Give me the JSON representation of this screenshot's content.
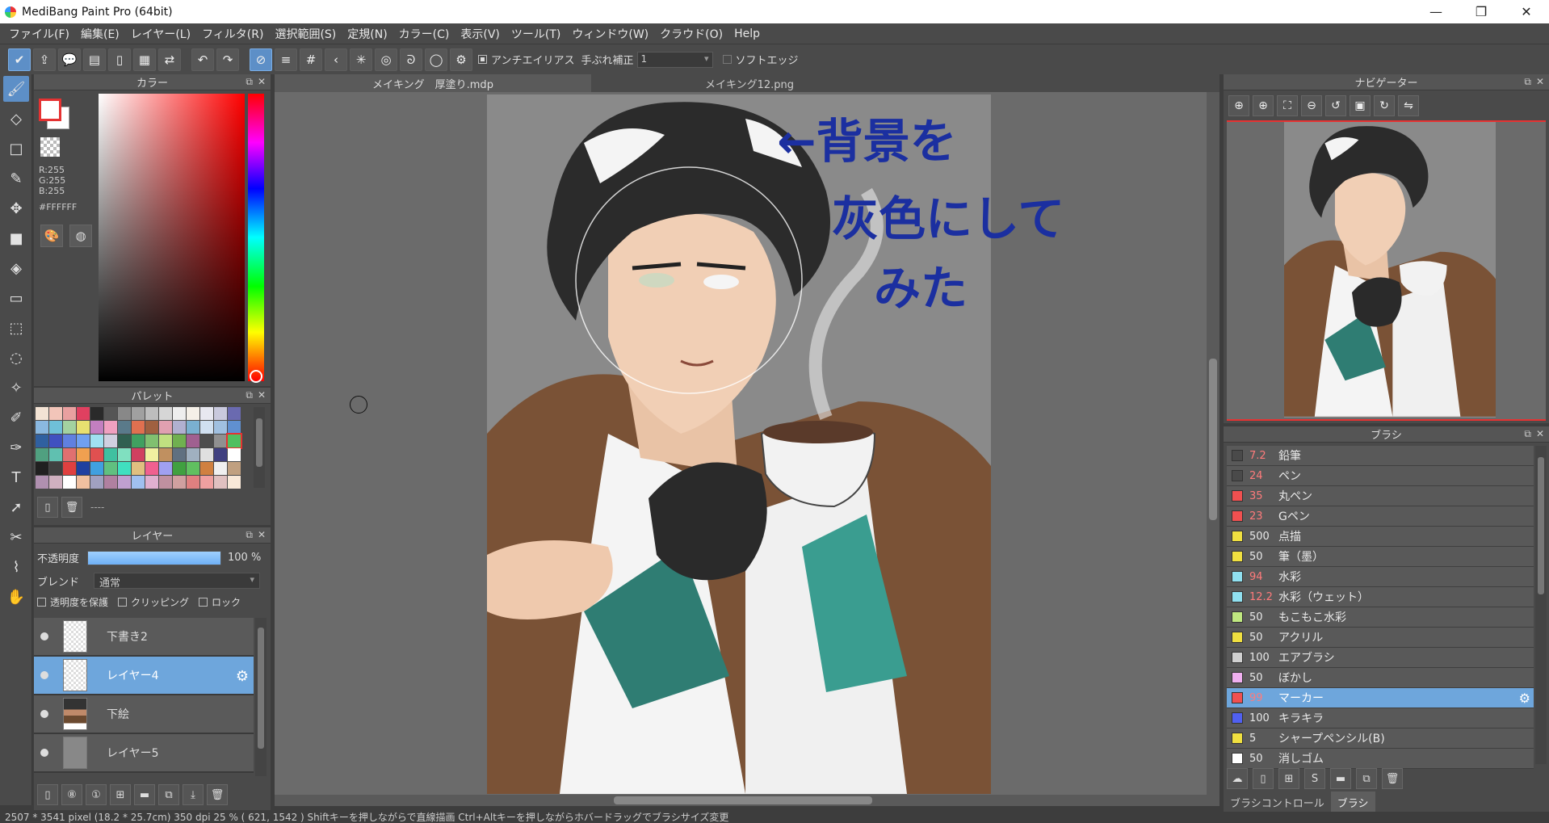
{
  "window": {
    "title": "MediBang Paint Pro (64bit)",
    "min": "—",
    "restore": "❐",
    "close": "✕"
  },
  "menu": [
    "ファイル(F)",
    "編集(E)",
    "レイヤー(L)",
    "フィルタ(R)",
    "選択範囲(S)",
    "定規(N)",
    "カラー(C)",
    "表示(V)",
    "ツール(T)",
    "ウィンドウ(W)",
    "クラウド(O)",
    "Help"
  ],
  "toolbar": {
    "antialias_label": "アンチエイリアス",
    "stabilizer_label": "手ぶれ補正",
    "stabilizer_value": "1",
    "soft_edge_label": "ソフトエッジ"
  },
  "color_panel": {
    "title": "カラー",
    "r": "R:255",
    "g": "G:255",
    "b": "B:255",
    "hex": "#FFFFFF",
    "foreground": "#e53232",
    "background": "#ffffff"
  },
  "palette_panel": {
    "title": "パレット",
    "name": "----",
    "colors": [
      "#f3e3d4",
      "#f2c5b9",
      "#e9a0a0",
      "#e04060",
      "#2a2a2a",
      "#555555",
      "#888888",
      "#a0a0a0",
      "#bdbdbd",
      "#d6d6d6",
      "#eeeeee",
      "#f5f0e8",
      "#e8e8f0",
      "#c9c9dd",
      "#6a6ab0",
      "#8ab8e0",
      "#6fc0d8",
      "#a3d2a0",
      "#e8e070",
      "#c37fc0",
      "#f0a0c0",
      "#5a7a8a",
      "#e07050",
      "#a06040",
      "#e0a0b0",
      "#b0b0d0",
      "#7ab0d0",
      "#d0e0f0",
      "#a0c0e0",
      "#6090d0",
      "#3060a0",
      "#4050c0",
      "#6080e0",
      "#70a0f0",
      "#a0e0f0",
      "#d0d0e0",
      "#306050",
      "#40a060",
      "#80c070",
      "#c0e080",
      "#70b050",
      "#a06090",
      "#4d4d4d",
      "#909090",
      "#50c060",
      "#50a080",
      "#60c0b0",
      "#e07070",
      "#f0a050",
      "#e05050",
      "#40c0a0",
      "#80e0c0",
      "#d04060",
      "#f0f0a0",
      "#c09060",
      "#607080",
      "#a0b0c0",
      "#e0e0e0",
      "#404080",
      "#ffffff",
      "#202020",
      "#404040",
      "#e04040",
      "#2040a0",
      "#40a0e0",
      "#60c080",
      "#40e0c0",
      "#e0c080",
      "#f06090",
      "#a0a0f0",
      "#40a040",
      "#60c060",
      "#d08040",
      "#f0f0f0",
      "#c0a080",
      "#b090b0",
      "#d0b0c0",
      "#ffffff",
      "#f0c0a0",
      "#a0a0c0",
      "#b080a0",
      "#c0a0d0",
      "#a0c0f0",
      "#e0b0d0",
      "#c090a0",
      "#d0a0a0",
      "#e08080",
      "#f0a0a0",
      "#e0c0c0",
      "#f8e8d8"
    ]
  },
  "layer_panel": {
    "title": "レイヤー",
    "opacity_label": "不透明度",
    "opacity_value": "100 %",
    "opacity_fraction": 1.0,
    "blend_label": "ブレンド",
    "blend_value": "通常",
    "protect_alpha": "透明度を保護",
    "clipping": "クリッピング",
    "lock": "ロック",
    "layers": [
      {
        "name": "下書き2",
        "selected": false,
        "thumb": "check"
      },
      {
        "name": "レイヤー4",
        "selected": true,
        "thumb": "check"
      },
      {
        "name": "下絵",
        "selected": false,
        "thumb": "art"
      },
      {
        "name": "レイヤー5",
        "selected": false,
        "thumb": "gray"
      }
    ]
  },
  "doc_tabs": [
    "メイキング　厚塗り.mdp",
    "メイキング12.png"
  ],
  "canvas": {
    "note_lines": [
      "←背景を",
      "灰色にして",
      "みた"
    ]
  },
  "navigator": {
    "title": "ナビゲーター"
  },
  "brush_panel": {
    "title": "ブラシ",
    "brushes": [
      {
        "size": "7.2",
        "name": "鉛筆",
        "color": "#4a4a4a",
        "red": true
      },
      {
        "size": "24",
        "name": "ペン",
        "color": "#4a4a4a",
        "red": true
      },
      {
        "size": "35",
        "name": "丸ペン",
        "color": "#f05050",
        "red": true
      },
      {
        "size": "23",
        "name": "Gペン",
        "color": "#f05050",
        "red": true
      },
      {
        "size": "500",
        "name": "点描",
        "color": "#f0e040",
        "red": false
      },
      {
        "size": "50",
        "name": "筆（墨）",
        "color": "#f0e040",
        "red": false
      },
      {
        "size": "94",
        "name": "水彩",
        "color": "#90e0f0",
        "red": true
      },
      {
        "size": "12.2",
        "name": "水彩（ウェット）",
        "color": "#90e0f0",
        "red": true
      },
      {
        "size": "50",
        "name": "もこもこ水彩",
        "color": "#c0e880",
        "red": false
      },
      {
        "size": "50",
        "name": "アクリル",
        "color": "#f0e040",
        "red": false
      },
      {
        "size": "100",
        "name": "エアブラシ",
        "color": "#d0d0d0",
        "red": false
      },
      {
        "size": "50",
        "name": "ぼかし",
        "color": "#f0b0f0",
        "red": false
      },
      {
        "size": "99",
        "name": "マーカー",
        "color": "#f05050",
        "red": true,
        "selected": true
      },
      {
        "size": "100",
        "name": "キラキラ",
        "color": "#5060f0",
        "red": false
      },
      {
        "size": "5",
        "name": "シャープペンシル(B)",
        "color": "#f0e040",
        "red": false
      },
      {
        "size": "50",
        "name": "消しゴム",
        "color": "#ffffff",
        "red": false
      }
    ],
    "tab_control": "ブラシコントロール",
    "tab_brush": "ブラシ"
  },
  "statusbar": "2507 * 3541 pixel  (18.2 * 25.7cm)  350 dpi  25 %  ( 621, 1542 )  Shiftキーを押しながらで直線描画  Ctrl+Altキーを押しながらホバードラッグでブラシサイズ変更"
}
